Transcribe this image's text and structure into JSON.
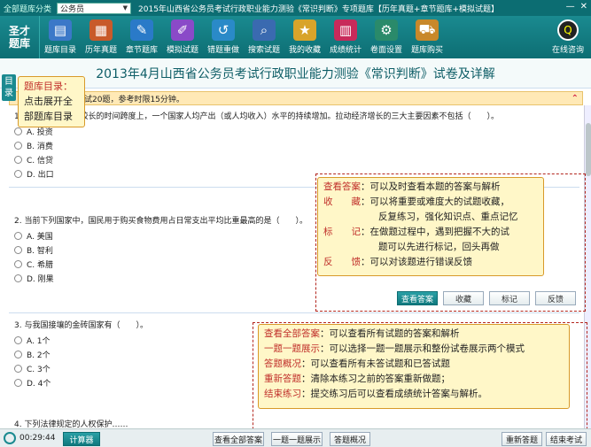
{
  "topbar": {
    "category_label": "全部题库分类",
    "category_value": "公务员",
    "window_title": "2015年山西省公务员考试行政职业能力测验《常识判断》专项题库【历年真题+章节题库+模拟试题】",
    "min": "—",
    "close": "✕"
  },
  "logo": {
    "line1": "圣才",
    "line2": "题库"
  },
  "toolbar": [
    {
      "label": "题库目录",
      "icon": "catalog-icon",
      "glyph": "▤",
      "color": "#3b78c8"
    },
    {
      "label": "历年真题",
      "icon": "past-exams-icon",
      "glyph": "▦",
      "color": "#c85a2a"
    },
    {
      "label": "章节题库",
      "icon": "chapters-icon",
      "glyph": "✎",
      "color": "#2a7ac8"
    },
    {
      "label": "模拟试题",
      "icon": "mock-exam-icon",
      "glyph": "✐",
      "color": "#8a4ac8"
    },
    {
      "label": "错题重做",
      "icon": "redo-mistakes-icon",
      "glyph": "↺",
      "color": "#2a8ac8"
    },
    {
      "label": "搜索试题",
      "icon": "search-icon",
      "glyph": "⌕",
      "color": "#3a6ab0"
    },
    {
      "label": "我的收藏",
      "icon": "favorites-icon",
      "glyph": "★",
      "color": "#d8a42a"
    },
    {
      "label": "成绩统计",
      "icon": "stats-icon",
      "glyph": "▥",
      "color": "#c82a5a"
    },
    {
      "label": "卷面设置",
      "icon": "settings-icon",
      "glyph": "⚙",
      "color": "#2a8a6a"
    },
    {
      "label": "题库购买",
      "icon": "cart-icon",
      "glyph": "⛟",
      "color": "#c8882a"
    }
  ],
  "online": {
    "label": "在线咨询",
    "glyph": "Q"
  },
  "main_title": "2013年4月山西省公务员考试行政职业能力测验《常识判断》试卷及详解",
  "side_tab": "目录",
  "section_header": "试20题，参考时限15分钟。",
  "questions": [
    {
      "stem": "1. ……是指在一个较长的时间跨度上，一个国家人均产出（或人均收入）水平的持续增加。拉动经济增长的三大主要因素不包括（　　）。",
      "options": [
        "A. 投资",
        "B. 消费",
        "C. 信贷",
        "D. 出口"
      ]
    },
    {
      "stem": "2. 当前下列国家中，国民用于购买食物费用占日常支出平均比重最高的是（　　）。",
      "options": [
        "A. 美国",
        "B. 智利",
        "C. 希腊",
        "D. 刚果"
      ],
      "buttons": [
        "查看答案",
        "收藏",
        "标记",
        "反馈"
      ]
    },
    {
      "stem": "3. 与我国接壤的金砖国家有（　　）。",
      "options": [
        "A. 1个",
        "B. 2个",
        "C. 3个",
        "D. 4个"
      ]
    },
    {
      "stem": "4. 下列法律规定的人权保护……"
    }
  ],
  "callout_catalog": {
    "line1": "题库目录：",
    "line2": "点击展开全",
    "line3": "部题库目录"
  },
  "callout_question": [
    {
      "k": "查看答案",
      "v": "：可以及时查看本题的答案与解析"
    },
    {
      "k": "收　　藏",
      "v": "：可以将重要或难度大的试题收藏，"
    },
    {
      "k": "",
      "v": "反复练习，强化知识点、重点记忆"
    },
    {
      "k": "标　　记",
      "v": "：在做题过程中，遇到把握不大的试"
    },
    {
      "k": "",
      "v": "题可以先进行标记，回头再做"
    },
    {
      "k": "反　　馈",
      "v": "：可以对该题进行错误反馈"
    }
  ],
  "callout_bottom": [
    {
      "k": "查看全部答案",
      "v": "：可以查看所有试题的答案和解析"
    },
    {
      "k": "一题一题展示",
      "v": "：可以选择一题一题展示和整份试卷展示两个模式"
    },
    {
      "k": "答题概况",
      "v": "：可以查看所有未答试题和已答试题"
    },
    {
      "k": "重新答题",
      "v": "：清除本练习之前的答案重新做题；"
    },
    {
      "k": "结束练习",
      "v": "：提交练习后可以查看成绩统计答案与解析。"
    }
  ],
  "bottom": {
    "timer": "00:29:44",
    "calculator": "计算器",
    "view_all": "查看全部答案",
    "one_by_one": "一题一题展示",
    "overview": "答题概况",
    "restart": "重新答题",
    "finish": "结束考试"
  },
  "colors": {
    "brand": "#0c6d72",
    "callout_key": "#c0302b",
    "callout_bg": "#fff7c8"
  }
}
